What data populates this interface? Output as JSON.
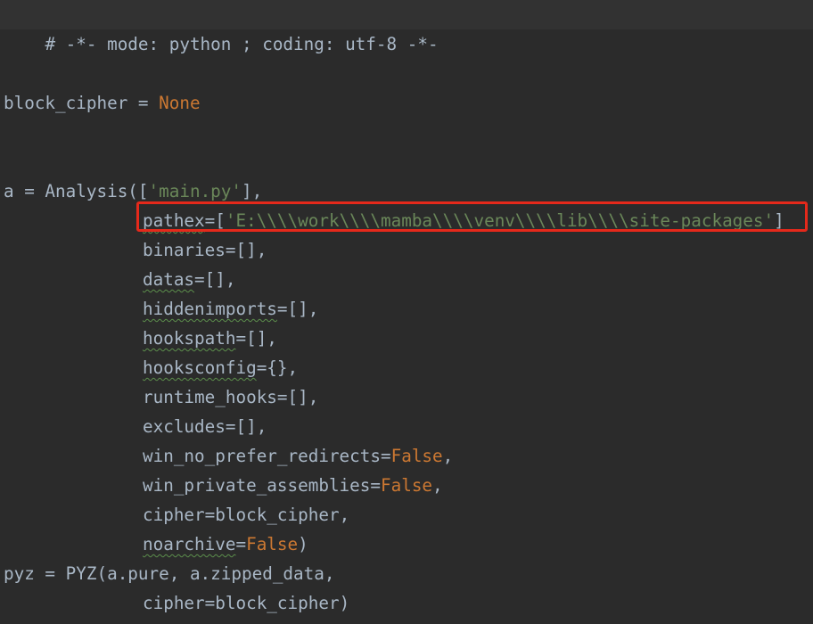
{
  "editor": {
    "header_comment": "# -*- mode: python ; coding: utf-8 -*-",
    "lines": {
      "block_cipher": {
        "name": "block_cipher",
        "op": " = ",
        "value": "None"
      },
      "analysis_open": {
        "a": "a = Analysis([",
        "str": "'main.py'",
        "tail": "],"
      },
      "pathex": {
        "param": "pathex",
        "eq": "=[",
        "str": "'E:\\\\\\\\work\\\\\\\\mamba\\\\\\\\venv\\\\\\\\lib\\\\\\\\site-packages'",
        "tail": "]"
      },
      "binaries": {
        "param": "binaries",
        "rest": "=[],"
      },
      "datas": {
        "param": "datas",
        "rest": "=[],"
      },
      "hiddenimports": {
        "param": "hiddenimports",
        "rest": "=[],"
      },
      "hookspath": {
        "param": "hookspath",
        "rest": "=[],"
      },
      "hooksconfig": {
        "param": "hooksconfig",
        "rest": "={},"
      },
      "runtime_hooks": {
        "param": "runtime_hooks",
        "rest": "=[],"
      },
      "excludes": {
        "param": "excludes",
        "rest": "=[],"
      },
      "win_no_prefer_redirects": {
        "param": "win_no_prefer_redirects",
        "eq": "=",
        "kw": "False",
        "tail": ","
      },
      "win_private_assemblies": {
        "param": "win_private_assemblies",
        "eq": "=",
        "kw": "False",
        "tail": ","
      },
      "cipher": {
        "param": "cipher",
        "rest": "=block_cipher,"
      },
      "noarchive": {
        "param": "noarchive",
        "eq": "=",
        "kw": "False",
        "tail": ")"
      },
      "pyz_open": {
        "text": "pyz = PYZ(a.pure, a.zipped_data,"
      },
      "pyz_cipher": {
        "param": "cipher",
        "rest": "=block_cipher)"
      }
    },
    "colors": {
      "background": "#2b2b2b",
      "text": "#a9b7c6",
      "keyword": "#cc7832",
      "string": "#6a8759",
      "highlight_border": "#e5291b",
      "typo_underline": "#5c8f4c"
    }
  }
}
